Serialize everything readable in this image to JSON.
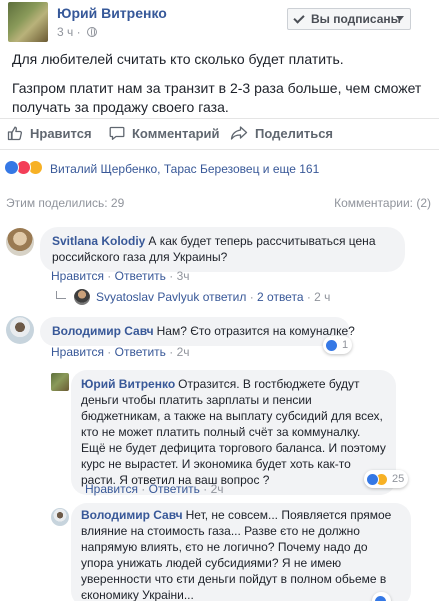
{
  "post": {
    "author": "Юрий Витренко",
    "time": "3 ч",
    "follow_label": "Вы подписаны",
    "text_line1": "Для любителей считать кто сколько будет платить.",
    "text_line2": "Газпром платит нам за транзит в 2-3 раза больше, чем сможет получать за продажу своего газа."
  },
  "actions": {
    "like": "Нравится",
    "comment": "Комментарий",
    "share": "Поделиться"
  },
  "reactions": {
    "names": "Виталий Щербенко, Тарас Березовец и еще 161",
    "icons": [
      "like-icon",
      "love-icon",
      "haha-icon"
    ],
    "colors": {
      "like": "#3578e5",
      "love": "#f33e58",
      "haha": "#f7b125"
    }
  },
  "summary": {
    "shares": "Этим поделились: 29",
    "comments": "Комментарии: (2)"
  },
  "comments": [
    {
      "author": "Svitlana Kolodiy",
      "text": "А как будет теперь рассчитываться цена российского газа для Украины?",
      "like": "Нравится",
      "reply": "Ответить",
      "time": "3ч",
      "reply_summary": {
        "author": "Svyatoslav Pavlyuk",
        "replied": "ответил",
        "count": "2 ответа",
        "time": "2 ч"
      }
    },
    {
      "author": "Володимир Савч",
      "text": "Нам? Єто отразится на комуналке?",
      "like": "Нравится",
      "reply": "Ответить",
      "time": "2ч",
      "reacts": "1"
    },
    {
      "author": "Юрий Витренко",
      "text": "Отразится. В гостбюджете будут деньги чтобы платить зарплаты и пенсии бюджетникам, а также на выплату субсидий для всех, кто не может платить полный счёт за коммуналку. Ещё не будет дефицита торгового баланса. И поэтому курс не вырастет. И экономика будет хоть как-то расти. Я ответил на ваш вопрос ?",
      "like": "Нравится",
      "reply": "Ответить",
      "time": "2ч",
      "reacts": "25"
    },
    {
      "author": "Володимир Савч",
      "text": "Нет, не совсем... Появляется прямое влияние на стоимость газа... Разве єто не должно напрямую влиять, єто не логично? Почему надо до упора унижать людей субсидиями? Я не имею уверенности что єти деньги пойдут в полном обьеме в єкономику Украіни..."
    }
  ]
}
